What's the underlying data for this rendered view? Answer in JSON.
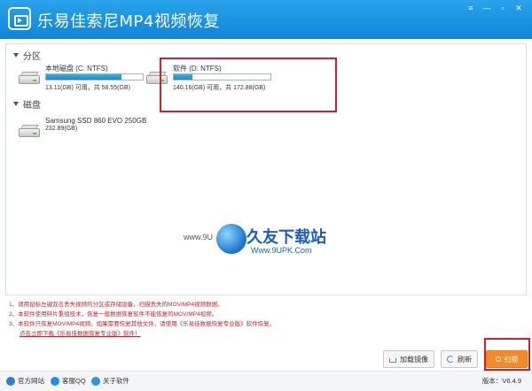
{
  "app": {
    "title": "乐易佳索尼MP4视频恢复",
    "window_controls": [
      "≡",
      "—",
      "▫",
      "✕"
    ]
  },
  "partitions": {
    "header": "分区",
    "drives": [
      {
        "name": "本地磁盘 (C: NTFS)",
        "info": "13.11(GB) 可用，共 58.55(GB)",
        "used_fraction": 0.78
      },
      {
        "name": "软件 (D: NTFS)",
        "info": "140.16(GB) 可用，共 172.88(GB)",
        "used_fraction": 0.19
      }
    ]
  },
  "disks": {
    "header": "磁盘",
    "drives": [
      {
        "name": "Samsung SSD 860 EVO 250GB",
        "info": "232.89(GB)"
      }
    ]
  },
  "watermark": {
    "left": "www.9U",
    "main": "久友下载站",
    "url": "Www.9UPK.Com"
  },
  "notes": [
    "1、请用鼠标左键双击丢失视频的分区或存储设备，扫描丢失的MOV/MP4视频数据。",
    "2、本软件使用碎片重组技术，恢复一般数据恢复软件不能恢复的MOV/MP4视频。",
    "3、本软件只恢复MOV/MP4视频。如果需要恢复其他文件，请使用《乐易佳数据恢复专业版》软件恢复。"
  ],
  "download_link": "点击立即下载《乐易佳数据恢复专业版》软件！",
  "buttons": {
    "load_image": "加载镜像",
    "refresh": "刷新",
    "scan": "扫描"
  },
  "footer": {
    "website": "官方网站",
    "qq": "客服QQ",
    "about": "关于软件",
    "version": "版本：V6.4.9"
  },
  "colors": {
    "titlebar": "#1a94e0",
    "scan_button": "#f58a2a",
    "note_text": "#c0262c",
    "highlight": "#d51f26"
  }
}
